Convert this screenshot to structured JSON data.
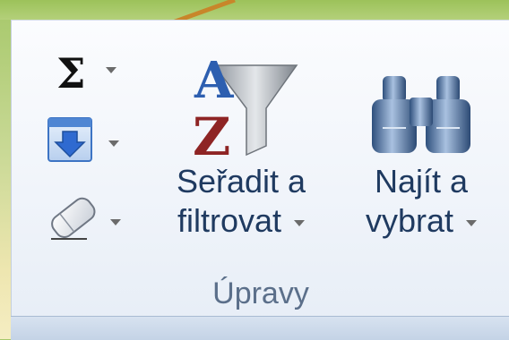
{
  "group": {
    "caption": "Úpravy",
    "buttons": {
      "autosum_icon": "sigma-icon",
      "fill_icon": "fill-down-icon",
      "clear_icon": "eraser-icon",
      "sort_filter_line1": "Seřadit a",
      "sort_filter_line2": "filtrovat",
      "find_select_line1": "Najít a",
      "find_select_line2": "vybrat",
      "sigma_symbol": "Σ"
    }
  },
  "colors": {
    "label_text": "#1f3a60",
    "caption_text": "#5b6f8a",
    "slide_background": "#c9d996",
    "callout_arrow": "#c8862a"
  }
}
